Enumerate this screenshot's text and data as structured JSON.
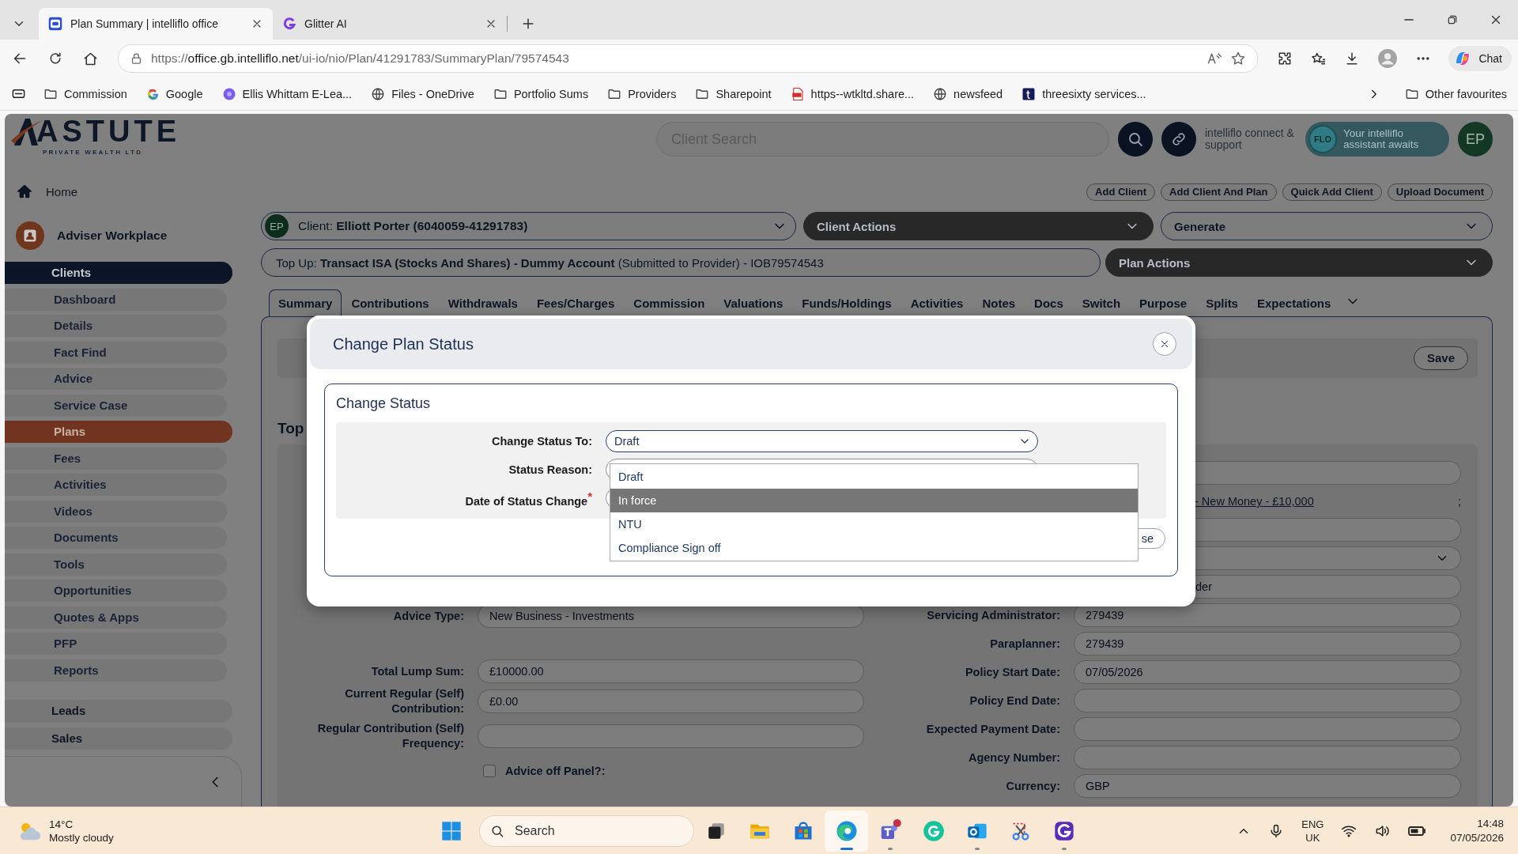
{
  "browser": {
    "tabs": [
      {
        "title": "Plan Summary | intelliflo office",
        "selected": true,
        "kind": "intelliflo"
      },
      {
        "title": "Glitter AI",
        "selected": false,
        "kind": "glitter"
      }
    ],
    "address": {
      "scheme": "https://",
      "host": "office.gb.intelliflo.net",
      "path": "/ui-io/nio/Plan/41291783/SummaryPlan/79574543"
    },
    "chat": "Chat",
    "bookmarks": [
      {
        "label": "Commission",
        "kind": "folder"
      },
      {
        "label": "Google",
        "kind": "google"
      },
      {
        "label": "Ellis Whittam E-Lea...",
        "kind": "site"
      },
      {
        "label": "Files - OneDrive",
        "kind": "globe"
      },
      {
        "label": "Portfolio Sums",
        "kind": "folder"
      },
      {
        "label": "Providers",
        "kind": "folder"
      },
      {
        "label": "Sharepoint",
        "kind": "folder"
      },
      {
        "label": "https--wtkltd.share...",
        "kind": "pdf"
      },
      {
        "label": "newsfeed",
        "kind": "globe"
      },
      {
        "label": "threesixty services...",
        "kind": "square"
      }
    ],
    "other_favourites": "Other favourites"
  },
  "sidebar": {
    "logo": {
      "name": "ASTUTE",
      "tagline": "PRIVATE WEALTH LTD"
    },
    "home": "Home",
    "workplace": "Adviser Workplace",
    "sections": [
      {
        "label": "Clients",
        "expanded": true,
        "items": [
          {
            "label": "Dashboard",
            "selected": false
          },
          {
            "label": "Details",
            "selected": false
          },
          {
            "label": "Fact Find",
            "selected": false
          },
          {
            "label": "Advice",
            "selected": false
          },
          {
            "label": "Service Case",
            "selected": false
          },
          {
            "label": "Plans",
            "selected": true
          },
          {
            "label": "Fees",
            "selected": false
          },
          {
            "label": "Activities",
            "selected": false
          },
          {
            "label": "Videos",
            "selected": false
          },
          {
            "label": "Documents",
            "selected": false
          },
          {
            "label": "Tools",
            "selected": false
          },
          {
            "label": "Opportunities",
            "selected": false
          },
          {
            "label": "Quotes & Apps",
            "selected": false
          },
          {
            "label": "PFP",
            "selected": false
          },
          {
            "label": "Reports",
            "selected": false
          }
        ]
      },
      {
        "label": "Leads",
        "expanded": false
      },
      {
        "label": "Sales",
        "expanded": false
      }
    ]
  },
  "header": {
    "search": {
      "placeholder": "Client Search"
    },
    "connect": "intelliflo connect & support",
    "assistant": {
      "badge": "FLO",
      "text": "Your intelliflo assistant awaits"
    },
    "avatar": "EP",
    "buttons": [
      "Add Client",
      "Add Client And Plan",
      "Quick Add Client",
      "Upload Document"
    ]
  },
  "client_bar": {
    "initials": "EP",
    "text": "Client: **Elliott Porter (6040059-41291783)**",
    "actions": "Client Actions",
    "generate": "Generate"
  },
  "plan_bar": {
    "text": "Top Up: **Transact ISA (Stocks And Shares) - Dummy Account** (Submitted to Provider) - IOB79574543",
    "actions": "Plan Actions"
  },
  "plan_tabs": [
    {
      "label": "Summary",
      "selected": true
    },
    {
      "label": "Contributions",
      "selected": false
    },
    {
      "label": "Withdrawals",
      "selected": false
    },
    {
      "label": "Fees/Charges",
      "selected": false
    },
    {
      "label": "Commission",
      "selected": false
    },
    {
      "label": "Valuations",
      "selected": false
    },
    {
      "label": "Funds/Holdings",
      "selected": false
    },
    {
      "label": "Activities",
      "selected": false
    },
    {
      "label": "Notes",
      "selected": false
    },
    {
      "label": "Docs",
      "selected": false
    },
    {
      "label": "Switch",
      "selected": false
    },
    {
      "label": "Purpose",
      "selected": false
    },
    {
      "label": "Splits",
      "selected": false
    },
    {
      "label": "Expectations",
      "selected": false
    }
  ],
  "summary": {
    "save": "Save",
    "heading": "Top",
    "left_fields": [
      {
        "label": "Advice Type:",
        "value": "New Business - Investments"
      },
      {
        "label": "Total Lump Sum:",
        "value": "£10000.00"
      },
      {
        "label": "Current Regular (Self) Contribution:",
        "value": "£0.00"
      },
      {
        "label": "Regular Contribution (Self) Frequency:"
      }
    ],
    "advice_off_panel": {
      "label": "Advice off Panel?:",
      "checked": false
    },
    "right_partial": [
      {
        "kind": "field"
      },
      {
        "kind": "link",
        "text": "- New Money - £10,000",
        "trailing": ";"
      },
      {
        "kind": "field"
      },
      {
        "kind": "select"
      },
      {
        "kind": "field",
        "value": "der"
      }
    ],
    "right_fields": [
      {
        "label": "Servicing Administrator:",
        "value": "279439"
      },
      {
        "label": "Paraplanner:",
        "value": "279439"
      },
      {
        "label": "Policy Start Date:",
        "value": "07/05/2026"
      },
      {
        "label": "Policy End Date:"
      },
      {
        "label": "Expected Payment Date:"
      },
      {
        "label": "Agency Number:"
      },
      {
        "label": "Currency:",
        "value": "GBP"
      }
    ]
  },
  "modal": {
    "title": "Change Plan Status",
    "section": "Change Status",
    "fields": [
      {
        "label": "Change Status To:",
        "kind": "select",
        "value": "Draft"
      },
      {
        "label": "Status Reason:",
        "kind": "text"
      },
      {
        "label": "Date of Status Change",
        "kind": "date",
        "required_mark": "*"
      }
    ],
    "options": [
      {
        "label": "Draft",
        "selected": false
      },
      {
        "label": "In force",
        "selected": true
      },
      {
        "label": "NTU",
        "selected": false
      },
      {
        "label": "Compliance Sign off",
        "selected": false
      }
    ],
    "close_fragment": "se"
  },
  "taskbar": {
    "weather": {
      "temp": "14°C",
      "condition": "Mostly cloudy"
    },
    "search": {
      "placeholder": "Search"
    },
    "apps": [
      {
        "kind": "taskview",
        "running": false,
        "selected": false
      },
      {
        "kind": "files",
        "running": false,
        "selected": false
      },
      {
        "kind": "store",
        "running": false,
        "selected": false
      },
      {
        "kind": "edge",
        "running": true,
        "selected": true
      },
      {
        "kind": "teams",
        "running": true,
        "selected": false
      },
      {
        "kind": "grammarly",
        "running": false,
        "selected": false
      },
      {
        "kind": "outlook",
        "running": true,
        "selected": false
      },
      {
        "kind": "snip",
        "running": false,
        "selected": false
      },
      {
        "kind": "glitter",
        "running": true,
        "selected": false
      }
    ],
    "language": "ENG",
    "region": "UK",
    "time": "14:48",
    "date": "07/05/2026"
  }
}
